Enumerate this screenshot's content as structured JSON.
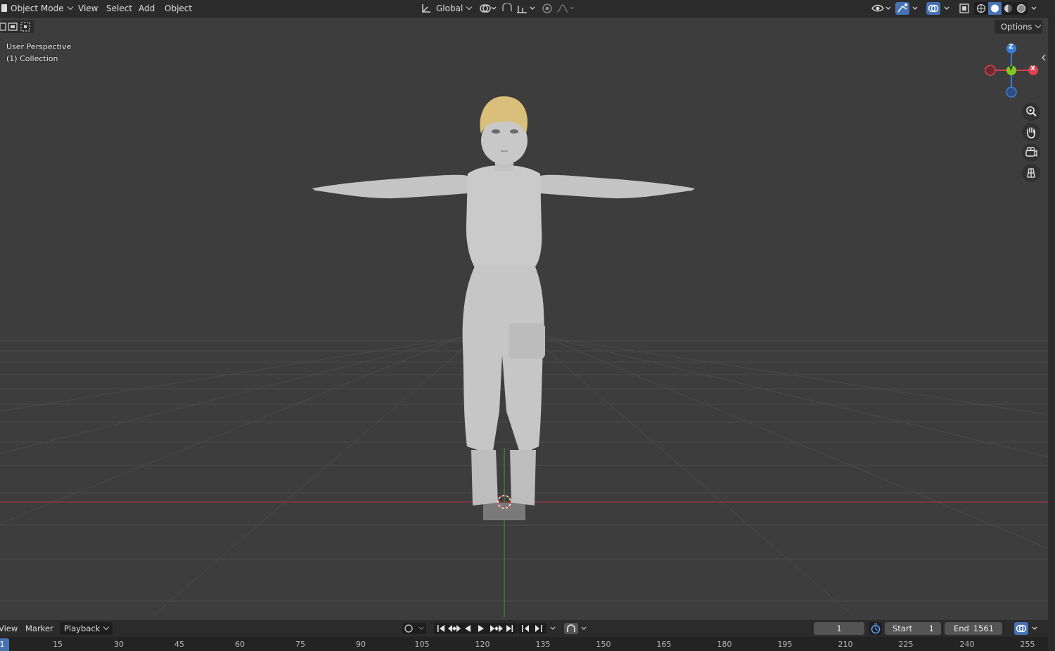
{
  "header": {
    "mode": "Object Mode",
    "menus": [
      "View",
      "Select",
      "Add",
      "Object"
    ],
    "orientation": "Global"
  },
  "viewport": {
    "perspective": "User Perspective",
    "collection": "(1) Collection",
    "options_label": "Options",
    "gizmo": {
      "z": "Z",
      "y": "Y",
      "x": "X"
    },
    "hair_color": "#d9bf7a",
    "model_color": "#c9c9c9"
  },
  "timeline": {
    "menus": [
      "View",
      "Marker",
      "Playback"
    ],
    "current_frame": "1",
    "start_label": "Start",
    "start_value": "1",
    "end_label": "End",
    "end_value": "1561",
    "ruler": [
      "1",
      "15",
      "30",
      "45",
      "60",
      "75",
      "90",
      "105",
      "120",
      "135",
      "150",
      "165",
      "180",
      "195",
      "210",
      "225",
      "240",
      "255"
    ]
  },
  "icons": {
    "nav": [
      "zoom-icon",
      "hand-pan-icon",
      "camera-view-icon",
      "grid-ortho-icon"
    ],
    "playback": [
      "jump-start-icon",
      "prev-keyframe-icon",
      "play-reverse-icon",
      "play-icon",
      "next-keyframe-icon",
      "jump-end-icon"
    ]
  },
  "colors": {
    "accent": "#4772b3",
    "axis_x": "#e04050",
    "axis_y": "#82c91e",
    "axis_z": "#3b7dd8"
  }
}
